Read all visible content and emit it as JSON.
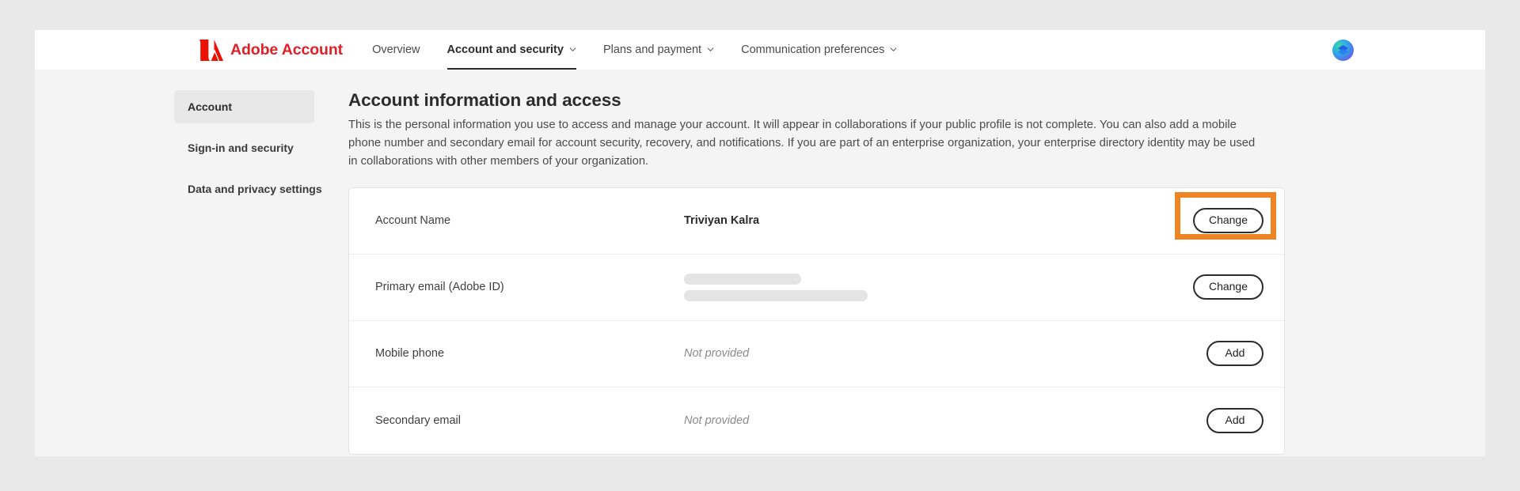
{
  "header": {
    "brand": "Adobe Account",
    "logo_icon": "adobe-a-logo",
    "avatar_icon": "user-avatar-layers",
    "nav": [
      {
        "label": "Overview",
        "has_caret": false,
        "active": false
      },
      {
        "label": "Account and security",
        "has_caret": true,
        "active": true
      },
      {
        "label": "Plans and payment",
        "has_caret": true,
        "active": false
      },
      {
        "label": "Communication preferences",
        "has_caret": true,
        "active": false
      }
    ]
  },
  "sidebar": {
    "items": [
      {
        "label": "Account",
        "active": true
      },
      {
        "label": "Sign-in and security",
        "active": false
      },
      {
        "label": "Data and privacy settings",
        "active": false
      }
    ]
  },
  "main": {
    "title": "Account information and access",
    "description": "This is the personal information you use to access and manage your account. It will appear in collaborations if your public profile is not complete. You can also add a mobile phone number and secondary email for account security, recovery, and notifications. If you are part of an enterprise organization, your enterprise directory identity may be used in collaborations with other members of your organization.",
    "rows": [
      {
        "label": "Account Name",
        "value": "Triviyan Kalra",
        "value_state": "text",
        "action": "Change",
        "highlighted": true
      },
      {
        "label": "Primary email (Adobe ID)",
        "value": "",
        "value_state": "redacted",
        "action": "Change",
        "highlighted": false
      },
      {
        "label": "Mobile phone",
        "value": "Not provided",
        "value_state": "muted",
        "action": "Add",
        "highlighted": false
      },
      {
        "label": "Secondary email",
        "value": "Not provided",
        "value_state": "muted",
        "action": "Add",
        "highlighted": false
      }
    ]
  },
  "colors": {
    "brand_red": "#e01f26",
    "highlight_orange": "#ee8424",
    "page_background": "#e9e9e9",
    "content_background": "#f4f4f4"
  }
}
